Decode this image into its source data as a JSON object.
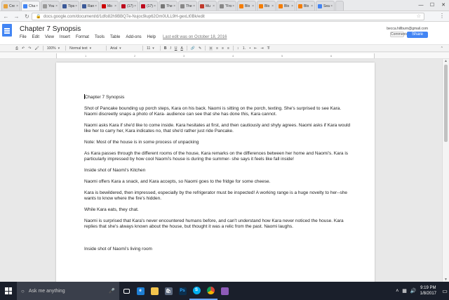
{
  "browser": {
    "tabs": [
      {
        "label": "Cre",
        "color": "#e6a23c"
      },
      {
        "label": "Cha",
        "color": "#4285f4"
      },
      {
        "label": "You",
        "color": "#999999"
      },
      {
        "label": "Tips",
        "color": "#3b5998"
      },
      {
        "label": "Ran",
        "color": "#3b5998"
      },
      {
        "label": "Mo",
        "color": "#cc0000"
      },
      {
        "label": "(17)",
        "color": "#bd081c"
      },
      {
        "label": "(17)",
        "color": "#bd081c"
      },
      {
        "label": "The",
        "color": "#777777"
      },
      {
        "label": "The",
        "color": "#888888"
      },
      {
        "label": "Mu",
        "color": "#c0392b"
      },
      {
        "label": "\"Fro",
        "color": "#888888"
      },
      {
        "label": "Blo",
        "color": "#f57d00"
      },
      {
        "label": "Blo",
        "color": "#f57d00"
      },
      {
        "label": "Blo",
        "color": "#f57d00"
      },
      {
        "label": "Blo",
        "color": "#f57d00"
      },
      {
        "label": "Sea",
        "color": "#4285f4"
      }
    ],
    "url": "docs.google.com/document/d/1dfo82h9BBQ7e-Nujoc9iup62Om0ULL9H-gexLt0Bk/edit"
  },
  "docs": {
    "title": "Chapter 7 Synopsis",
    "menu": [
      "File",
      "Edit",
      "View",
      "Insert",
      "Format",
      "Tools",
      "Table",
      "Add-ons",
      "Help"
    ],
    "last_edit": "Last edit was on October 18, 2016",
    "email": "becca.hillburn@gmail.com",
    "comments_label": "Comments",
    "share_label": "Share"
  },
  "toolbar": {
    "zoom": "100%",
    "style": "Normal text",
    "font": "Arial",
    "size": "11",
    "bold": "B",
    "italic": "I",
    "underline": "U",
    "text_color": "A"
  },
  "document": {
    "paragraphs": [
      "Chapter 7 Synopsis",
      "Shot of Pancake bounding up porch steps, Kara on his back. Naomi is sitting on the porch, texting. She's surprised to see Kara.  Naomi discreetly snaps a photo of Kara- audience can see that she has done this, Kara cannot.",
      "Naomi asks Kara if she'd like to come inside. Kara hesitates at first, and then cautiously and shyly agrees. Naomi asks if Kara would like her to carry her, Kara indicates no, that she'd rather just ride Pancake.",
      "Note: Most of the house is in some process of unpacking",
      "As Kara passes through the different rooms of the house, Kara remarks on the differences between her home and Naomi's.   Kara is particularly impressed by how cool Naomi's house is during the summer- she says it feels like fall inside!",
      "Inside shot of Naomi's Kitchen",
      "Naomi offers Kara a snack, and Kara accepts, so Naomi goes to the fridge for some cheese.",
      "Kara is bewildered, then impressed, especially by the refrigerator must be inspected! A working range is a huge novelty to her--she wants to know where the fire's hidden.",
      "While Kara eats, they chat.",
      "Naomi is surprised that Kara's never encountered humans before, and can't understand how Kara never noticed the house. Kara replies that she's always known about the house, but thought it was a relic from the past.  Naomi laughs.",
      "",
      "Inside shot of Naomi's living room"
    ]
  },
  "taskbar": {
    "search_placeholder": "Ask me anything",
    "time": "9:19 PM",
    "date": "1/8/2017"
  }
}
